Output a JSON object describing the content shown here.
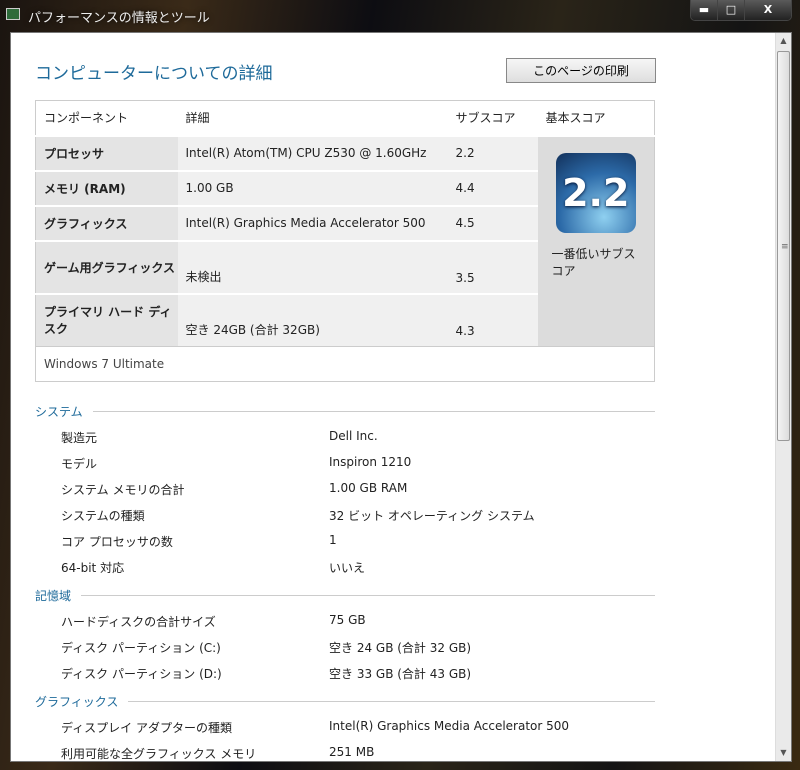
{
  "window": {
    "title": "パフォーマンスの情報とツール",
    "min": "▬",
    "max": "□",
    "close": "X"
  },
  "page": {
    "title": "コンピューターについての詳細",
    "print_button": "このページの印刷"
  },
  "table": {
    "headers": [
      "コンポーネント",
      "詳細",
      "サブスコア",
      "基本スコア"
    ],
    "rows": [
      {
        "component": "プロセッサ",
        "detail": "Intel(R) Atom(TM) CPU Z530 @ 1.60GHz",
        "subscore": "2.2"
      },
      {
        "component": "メモリ (RAM)",
        "detail": "1.00 GB",
        "subscore": "4.4"
      },
      {
        "component": "グラフィックス",
        "detail": "Intel(R) Graphics Media Accelerator 500",
        "subscore": "4.5"
      },
      {
        "component": "ゲーム用グラフィックス",
        "detail": "未検出",
        "subscore": "3.5"
      },
      {
        "component": "プライマリ ハード ディスク",
        "detail": "空き 24GB (合計 32GB)",
        "subscore": "4.3"
      }
    ],
    "base_score": "2.2",
    "base_score_note": "一番低いサブスコア",
    "os": "Windows 7 Ultimate"
  },
  "sections": [
    {
      "title": "システム",
      "items": [
        [
          "製造元",
          "Dell Inc."
        ],
        [
          "モデル",
          "Inspiron 1210"
        ],
        [
          "システム メモリの合計",
          "1.00 GB RAM"
        ],
        [
          "システムの種類",
          "32 ビット オペレーティング システム"
        ],
        [
          "コア プロセッサの数",
          "1"
        ],
        [
          "64-bit 対応",
          "いいえ"
        ]
      ]
    },
    {
      "title": "記憶域",
      "items": [
        [
          "ハードディスクの合計サイズ",
          "75 GB"
        ],
        [
          "ディスク パーティション (C:)",
          "空き 24 GB (合計 32 GB)"
        ],
        [
          "ディスク パーティション (D:)",
          "空き 33 GB (合計 43 GB)"
        ]
      ]
    },
    {
      "title": "グラフィックス",
      "items": [
        [
          "ディスプレイ アダプターの種類",
          "Intel(R) Graphics Media Accelerator 500"
        ],
        [
          "利用可能な全グラフィックス メモリ",
          "251 MB"
        ]
      ]
    }
  ]
}
